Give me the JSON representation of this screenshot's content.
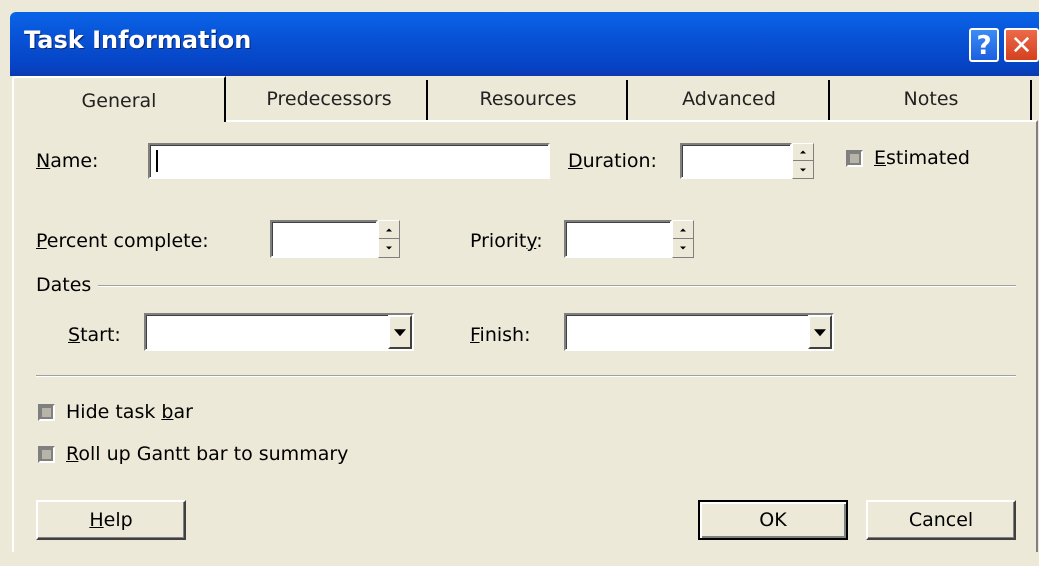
{
  "window": {
    "title": "Task Information",
    "help_glyph": "?",
    "close_glyph": "✕"
  },
  "tabs": [
    {
      "label": "General",
      "active": true
    },
    {
      "label": "Predecessors"
    },
    {
      "label": "Resources"
    },
    {
      "label": "Advanced"
    },
    {
      "label": "Notes"
    }
  ],
  "general": {
    "name": {
      "label_u": "N",
      "label_rest": "ame:",
      "value": ""
    },
    "duration": {
      "label_u": "D",
      "label_rest": "uration:",
      "value": ""
    },
    "estimated": {
      "label_u": "E",
      "label_rest": "stimated",
      "checked": true
    },
    "percent_complete": {
      "label_u": "P",
      "label_rest": "ercent complete:",
      "value": ""
    },
    "priority": {
      "label_pre": "Priorit",
      "label_u": "y",
      "label_post": ":",
      "value": ""
    },
    "dates": {
      "group_label": "Dates",
      "start": {
        "label_u": "S",
        "label_rest": "tart:",
        "value": ""
      },
      "finish": {
        "label_u": "F",
        "label_rest": "inish:",
        "value": ""
      }
    },
    "hide_task_bar": {
      "label_pre": "Hide task ",
      "label_u": "b",
      "label_post": "ar",
      "checked": true
    },
    "roll_up": {
      "label_u": "R",
      "label_rest": "oll up Gantt bar to summary",
      "checked": true
    }
  },
  "buttons": {
    "help": {
      "label_u": "H",
      "label_rest": "elp"
    },
    "ok": "OK",
    "cancel": "Cancel"
  },
  "colors": {
    "titlebar": "#0852d6",
    "dialog_face": "#ece9d8",
    "close_button": "#d4411f"
  }
}
